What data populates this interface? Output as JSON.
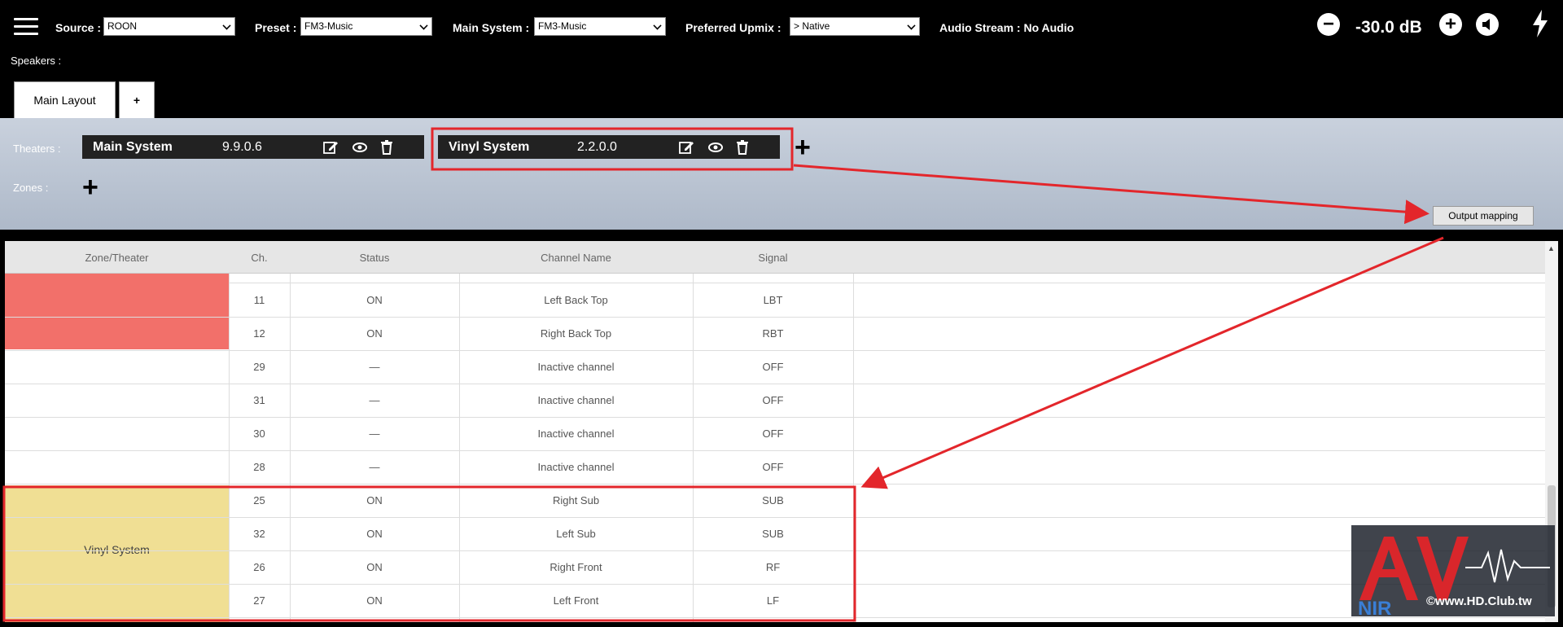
{
  "topbar": {
    "source_label": "Source :",
    "source_value": "ROON",
    "preset_label": "Preset :",
    "preset_value": "FM3-Music",
    "main_system_label": "Main System :",
    "main_system_value": "FM3-Music",
    "upmix_label": "Preferred Upmix :",
    "upmix_value": "> Native",
    "audio_stream": "Audio Stream : No Audio",
    "volume": "-30.0 dB"
  },
  "speakers_label": "Speakers :",
  "tabs": [
    {
      "label": "Main Layout",
      "active": true
    },
    {
      "label": "+"
    }
  ],
  "theaters_label": "Theaters :",
  "zones_label": "Zones :",
  "theaters": [
    {
      "name": "Main System",
      "version": "9.9.0.6"
    },
    {
      "name": "Vinyl System",
      "version": "2.2.0.0"
    }
  ],
  "output_mapping_label": "Output mapping",
  "table": {
    "headers": [
      "Zone/Theater",
      "Ch.",
      "Status",
      "Channel Name",
      "Signal"
    ],
    "zone_label": "Vinyl System",
    "rows": [
      {
        "ch": "11",
        "status": "ON",
        "name": "Left Back Top",
        "signal": "LBT"
      },
      {
        "ch": "12",
        "status": "ON",
        "name": "Right Back Top",
        "signal": "RBT"
      },
      {
        "ch": "29",
        "status": "—",
        "name": "Inactive channel",
        "signal": "OFF"
      },
      {
        "ch": "31",
        "status": "—",
        "name": "Inactive channel",
        "signal": "OFF"
      },
      {
        "ch": "30",
        "status": "—",
        "name": "Inactive channel",
        "signal": "OFF"
      },
      {
        "ch": "28",
        "status": "—",
        "name": "Inactive channel",
        "signal": "OFF"
      },
      {
        "ch": "25",
        "status": "ON",
        "name": "Right Sub",
        "signal": "SUB"
      },
      {
        "ch": "32",
        "status": "ON",
        "name": "Left Sub",
        "signal": "SUB"
      },
      {
        "ch": "26",
        "status": "ON",
        "name": "Right Front",
        "signal": "RF"
      },
      {
        "ch": "27",
        "status": "ON",
        "name": "Left Front",
        "signal": "LF"
      }
    ]
  },
  "watermark": {
    "logo_text": "AV NIR",
    "site": "©www.HD.Club.tw"
  },
  "colors": {
    "highlight_red": "#e3262b",
    "zone_main": "#f2706a",
    "zone_vinyl": "#f0df94"
  }
}
